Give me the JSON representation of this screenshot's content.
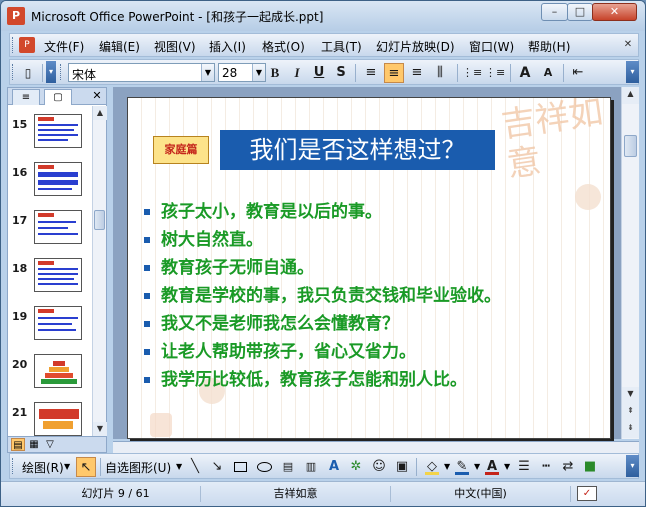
{
  "window": {
    "title": "Microsoft Office PowerPoint - [和孩子一起成长.ppt]",
    "app_icon": "powerpoint-icon",
    "controls": {
      "minimize": "–",
      "maximize": "□",
      "close": "✕"
    }
  },
  "menu": {
    "items": [
      "文件(F)",
      "编辑(E)",
      "视图(V)",
      "插入(I)",
      "格式(O)",
      "工具(T)",
      "幻灯片放映(D)",
      "窗口(W)",
      "帮助(H)"
    ],
    "end_button": "✕"
  },
  "format_toolbar": {
    "font_name": "宋体",
    "font_size": "28",
    "buttons": {
      "bold": "B",
      "italic": "I",
      "underline": "U",
      "shadow": "S",
      "align_left": "≡",
      "align_center": "≡",
      "align_right": "≡",
      "distribute": "⫼",
      "numbering": "⋮≡",
      "bullets": "⋮≡",
      "grow_font": "A",
      "shrink_font": "A",
      "decrease_indent": "⇤"
    },
    "active_alignment": "center"
  },
  "side_pane": {
    "tabs": [
      {
        "label": "≡",
        "selected": false
      },
      {
        "label": "▢",
        "selected": true
      }
    ],
    "close": "✕",
    "thumbnails": [
      {
        "number": "15",
        "selected": false
      },
      {
        "number": "16",
        "selected": false
      },
      {
        "number": "17",
        "selected": false
      },
      {
        "number": "18",
        "selected": false
      },
      {
        "number": "19",
        "selected": true
      },
      {
        "number": "20",
        "selected": false
      },
      {
        "number": "21",
        "selected": false
      }
    ],
    "view_buttons": [
      "▤",
      "▦",
      "▽"
    ]
  },
  "slide": {
    "tag": "家庭篇",
    "title": "我们是否这样想过？",
    "bullets": [
      "孩子太小，教育是以后的事。",
      "树大自然直。",
      "教育孩子无师自通。",
      "教育是学校的事，我只负责交钱和毕业验收。",
      "我又不是老师我怎么会懂教育？",
      "让老人帮助带孩子，省心又省力。",
      "我学历比较低，教育孩子怎能和别人比。"
    ],
    "decoration_text": "吉祥如意",
    "colors": {
      "title_bg": "#1a5cae",
      "bullet_text": "#1a9a26",
      "tag_text": "#c4241a"
    }
  },
  "editor_scroll": {
    "up": "▲",
    "down": "▼",
    "prev": "⇞",
    "next": "⇟"
  },
  "draw_toolbar": {
    "draw_label": "绘图(R)",
    "autoshapes_label": "自选图形(U)",
    "line_color": "#1a5cae",
    "font_color": "#c4241a",
    "fill_color": "#f3d349"
  },
  "status": {
    "slide_info": "幻灯片 9 / 61",
    "design": "吉祥如意",
    "language": "中文(中国)"
  }
}
